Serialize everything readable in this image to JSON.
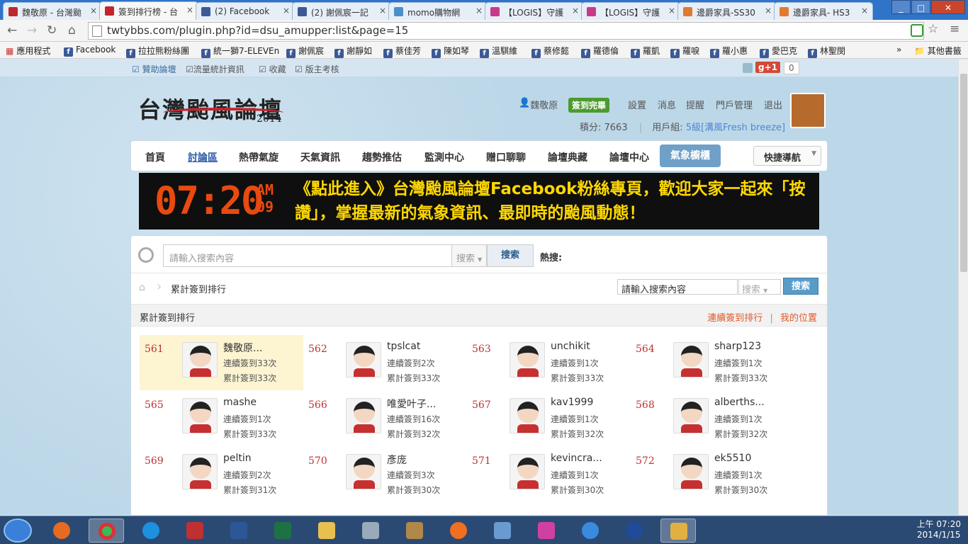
{
  "browser": {
    "tabs": [
      {
        "label": "魏敬原 - 台灣颱",
        "color": "#c0272d"
      },
      {
        "label": "簽到排行榜 - 台",
        "color": "#c0272d",
        "active": true
      },
      {
        "label": "(2) Facebook",
        "color": "#3b5998"
      },
      {
        "label": "(2) 謝佩宸一記",
        "color": "#3b5998"
      },
      {
        "label": "momo購物網",
        "color": "#4a90c8"
      },
      {
        "label": "【LOGIS】守護",
        "color": "#c83a8c"
      },
      {
        "label": "【LOGIS】守護",
        "color": "#c83a8c"
      },
      {
        "label": "邊爵家具-SS30",
        "color": "#e07a30"
      },
      {
        "label": "邊爵家具- HS3",
        "color": "#e07a30"
      }
    ],
    "url": "twtybbs.com/plugin.php?id=dsu_amupper:list&page=15",
    "bookmarks": [
      {
        "label": "應用程式",
        "fb": false
      },
      {
        "label": "Facebook",
        "fb": true
      },
      {
        "label": "拉拉熊粉絲團",
        "fb": true
      },
      {
        "label": "統一獅7-ELEVEn",
        "fb": true
      },
      {
        "label": "謝佩宸",
        "fb": true
      },
      {
        "label": "謝靜如",
        "fb": true
      },
      {
        "label": "蔡佳芳",
        "fb": true
      },
      {
        "label": "陳如琴",
        "fb": true
      },
      {
        "label": "溫騏維",
        "fb": true
      },
      {
        "label": "蔡修懿",
        "fb": true
      },
      {
        "label": "羅德倫",
        "fb": true
      },
      {
        "label": "羅凱",
        "fb": true
      },
      {
        "label": "羅唳",
        "fb": true
      },
      {
        "label": "羅小惠",
        "fb": true
      },
      {
        "label": "愛巴克",
        "fb": true
      },
      {
        "label": "林聖閔",
        "fb": true
      }
    ],
    "other_bookmarks": "其他書籤",
    "more": "»"
  },
  "site": {
    "topbar": [
      "☑ 贊助論壇",
      "☑流量統計資訊",
      "☑ 收藏",
      "☑ 版主考核"
    ],
    "gplus": "g+1",
    "gplus_count": "0",
    "logo": "台灣颱風論壇",
    "logo_year": "2014",
    "user": {
      "name": "魏敬原",
      "signed": "簽到完畢",
      "links": [
        "設置",
        "消息",
        "提醒",
        "門戶管理",
        "退出"
      ],
      "credits": "積分: 7663",
      "group_label": "用戶組:",
      "group": "5級[溝風Fresh breeze]"
    },
    "nav": [
      "首頁",
      "討論區",
      "熱帶氣旋",
      "天氣資訊",
      "趨勢推估",
      "監測中心",
      "贈口聊聊",
      "論壇典藏",
      "論壇中心"
    ],
    "nav_active": "氣象櫥櫃",
    "quicknav": "快捷導航",
    "banner": {
      "clock": "07:20",
      "am": "AM",
      "sec": "09",
      "text": "《點此進入》台灣颱風論壇Facebook粉絲專頁，歡迎大家一起來「按讚」，掌握最新的氣象資訊、最即時的颱風動態！"
    },
    "search": {
      "placeholder": "請輸入搜索內容",
      "select": "搜索",
      "button": "搜索",
      "hot": "熱搜:"
    },
    "crumb": "累計簽到排行",
    "search2": {
      "value": "請輸入搜索內容",
      "select": "搜索",
      "button": "搜索"
    },
    "list_title": "累計簽到排行",
    "list_links": [
      "連續簽到排行",
      "|",
      "我的位置"
    ],
    "entries": [
      {
        "rank": "561",
        "name": "魏敬原...",
        "cont": "連續簽到33次",
        "total": "累計簽到33次",
        "hl": true
      },
      {
        "rank": "562",
        "name": "tpslcat",
        "cont": "連續簽到2次",
        "total": "累計簽到33次"
      },
      {
        "rank": "563",
        "name": "unchikit",
        "cont": "連續簽到1次",
        "total": "累計簽到33次"
      },
      {
        "rank": "564",
        "name": "sharp123",
        "cont": "連續簽到1次",
        "total": "累計簽到33次"
      },
      {
        "rank": "565",
        "name": "mashe",
        "cont": "連續簽到1次",
        "total": "累計簽到33次"
      },
      {
        "rank": "566",
        "name": "唯愛叶子...",
        "cont": "連續簽到16次",
        "total": "累計簽到32次"
      },
      {
        "rank": "567",
        "name": "kav1999",
        "cont": "連續簽到1次",
        "total": "累計簽到32次"
      },
      {
        "rank": "568",
        "name": "alberths...",
        "cont": "連續簽到1次",
        "total": "累計簽到32次"
      },
      {
        "rank": "569",
        "name": "peltin",
        "cont": "連續簽到2次",
        "total": "累計簽到31次"
      },
      {
        "rank": "570",
        "name": "彥庞",
        "cont": "連續簽到3次",
        "total": "累計簽到30次"
      },
      {
        "rank": "571",
        "name": "kevincra...",
        "cont": "連續簽到1次",
        "total": "累計簽到30次"
      },
      {
        "rank": "572",
        "name": "ek5510",
        "cont": "連續簽到1次",
        "total": "累計簽到30次"
      }
    ]
  },
  "taskbar": {
    "time": "上午 07:20",
    "date": "2014/1/15"
  }
}
